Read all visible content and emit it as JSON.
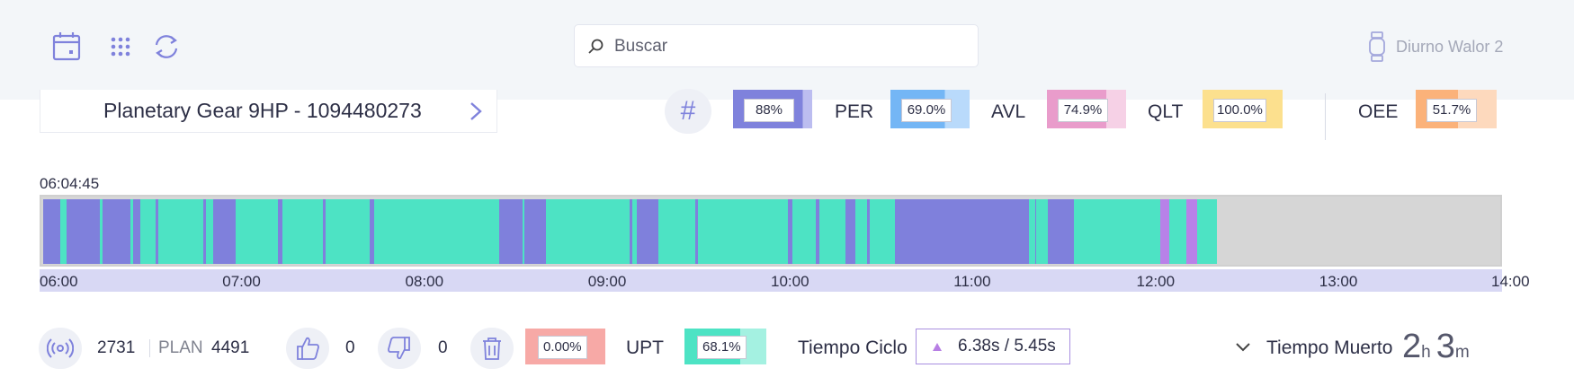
{
  "search": {
    "placeholder": "Buscar"
  },
  "user": {
    "name": "Diurno Walor 2"
  },
  "product": {
    "name": "Planetary Gear 9HP - 1094480273"
  },
  "kpis": {
    "first": {
      "value": "88%",
      "fill": 0.88,
      "color": "#7f82dc",
      "light": "#bcbdf0"
    },
    "per": {
      "label": "PER",
      "value": "69.0%",
      "fill": 0.69,
      "color": "#74b6f5",
      "light": "#b9dafb"
    },
    "avl": {
      "label": "AVL",
      "value": "74.9%",
      "fill": 0.749,
      "color": "#e99ccb",
      "light": "#f6d1e6"
    },
    "qlt": {
      "label": "QLT",
      "value": "100.0%",
      "fill": 1.0,
      "color": "#fce08e",
      "light": "#fdeec4"
    },
    "oee": {
      "label": "OEE",
      "value": "51.7%",
      "fill": 0.517,
      "color": "#fbb27a",
      "light": "#fdd9bd"
    }
  },
  "timeline": {
    "start_label": "06:04:45",
    "ticks": [
      "06:00",
      "07:00",
      "08:00",
      "09:00",
      "10:00",
      "11:00",
      "12:00",
      "13:00",
      "14:00"
    ],
    "colors": {
      "run": "#4de3c4",
      "stop": "#7f80dc",
      "other": "#b881e8",
      "empty": "#d6d6d6"
    }
  },
  "bottom": {
    "count": "2731",
    "plan_label": "PLAN",
    "plan_value": "4491",
    "good": "0",
    "bad": "0",
    "scrap_pct": {
      "value": "0.00%",
      "color": "#f7a9a6"
    },
    "upt": {
      "label": "UPT",
      "value": "68.1%",
      "fill": 0.681,
      "color": "#4de3c4",
      "light": "#a4f1e1"
    },
    "cycle": {
      "label": "Tiempo Ciclo",
      "value": "6.38s / 5.45s"
    },
    "muerto": {
      "label": "Tiempo Muerto",
      "hours": "2",
      "h_unit": "h",
      "minutes": "3",
      "m_unit": "m"
    }
  }
}
